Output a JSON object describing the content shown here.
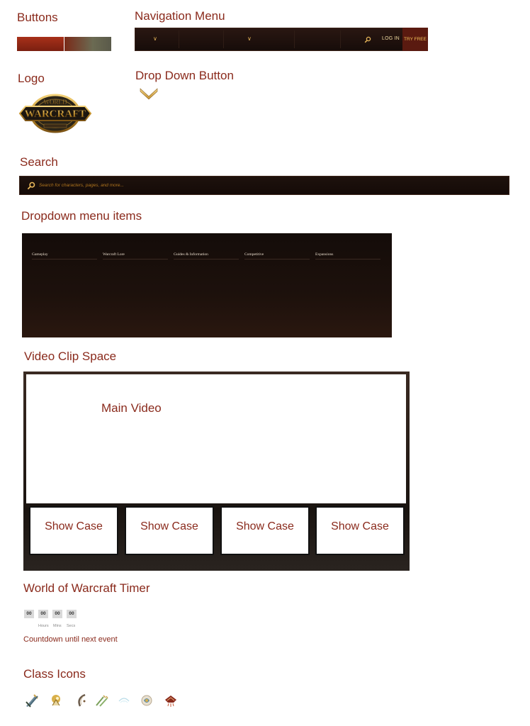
{
  "headings": {
    "buttons": "Buttons",
    "navigation_menu": "Navigation Menu",
    "logo": "Logo",
    "drop_down_button": "Drop Down Button",
    "search": "Search",
    "dropdown_menu_items": "Dropdown menu items",
    "video_clip_space": "Video Clip Space",
    "timer": "World of Warcraft Timer",
    "class_icons": "Class Icons"
  },
  "nav": {
    "login_label": "LOG IN",
    "try_label": "TRY FREE"
  },
  "logo": {
    "text_top": "WORLD",
    "text_main": "WARCRAFT"
  },
  "search": {
    "placeholder": "Search for characters, pages, and more..."
  },
  "dropdown_menu": {
    "items": [
      "Gameplay",
      "Warcraft Lore",
      "Guides & Information",
      "Competitive",
      "Expansions"
    ]
  },
  "video": {
    "main_label": "Main Video",
    "showcase_labels": [
      "Show Case",
      "Show Case",
      "Show Case",
      "Show Case"
    ]
  },
  "timer": {
    "values": [
      "00",
      "00",
      "00",
      "00"
    ],
    "labels": [
      "Hours",
      "Mins",
      "Secs"
    ],
    "caption": "Countdown until next event"
  },
  "colors": {
    "heading": "#8a2a1c",
    "accent_gold": "#e8b75a",
    "dark_bg": "#1a0f0b"
  },
  "class_icons": [
    "warrior-icon",
    "paladin-icon",
    "hunter-icon",
    "rogue-icon",
    "priest-icon",
    "shaman-icon",
    "mage-icon"
  ]
}
